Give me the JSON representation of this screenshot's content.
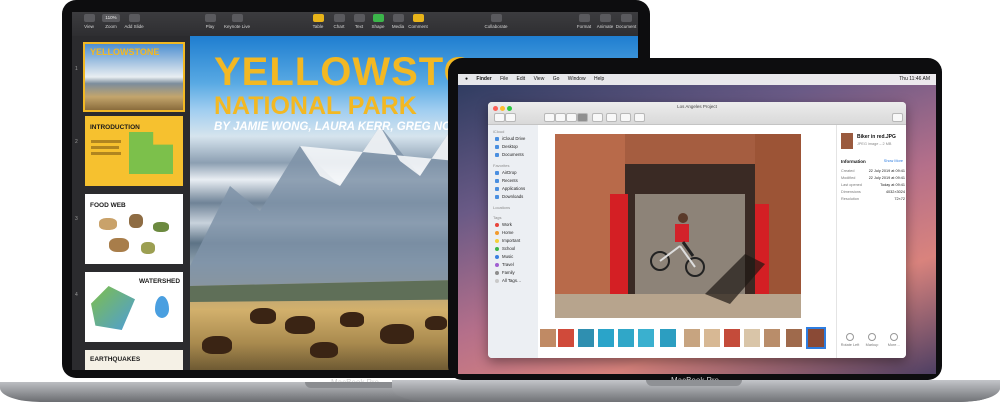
{
  "keynote": {
    "toolbar": [
      {
        "label": "View",
        "icon": "sidebar-icon"
      },
      {
        "label": "Zoom",
        "icon": "zoom-icon",
        "value": "110%"
      },
      {
        "label": "Add Slide",
        "icon": "plus-icon"
      },
      {
        "label": "Play",
        "icon": "play-icon"
      },
      {
        "label": "Keynote Live",
        "icon": "keynote-live-icon"
      },
      {
        "label": "Table",
        "icon": "table-icon"
      },
      {
        "label": "Chart",
        "icon": "chart-icon"
      },
      {
        "label": "Text",
        "icon": "text-icon"
      },
      {
        "label": "Shape",
        "icon": "shape-icon"
      },
      {
        "label": "Media",
        "icon": "media-icon"
      },
      {
        "label": "Comment",
        "icon": "comment-icon"
      },
      {
        "label": "Collaborate",
        "icon": "collaborate-icon"
      },
      {
        "label": "Format",
        "icon": "format-icon"
      },
      {
        "label": "Animate",
        "icon": "animate-icon"
      },
      {
        "label": "Document",
        "icon": "document-icon"
      }
    ],
    "slides": [
      {
        "number": "1",
        "title": "YELLOWSTONE"
      },
      {
        "number": "2",
        "title": "INTRODUCTION"
      },
      {
        "number": "3",
        "title": "FOOD WEB"
      },
      {
        "number": "4",
        "title": "WATERSHED"
      },
      {
        "number": "5",
        "title": "EARTHQUAKES"
      }
    ],
    "canvas": {
      "title": "YELLOWSTO",
      "subtitle": "NATIONAL PARK",
      "byline": "BY JAMIE WONG, LAURA KERR, GREG NOVICK"
    },
    "device_label": "MacBook Pro"
  },
  "finder": {
    "menubar": {
      "items": [
        "Finder",
        "File",
        "Edit",
        "View",
        "Go",
        "Window",
        "Help"
      ],
      "status": "Thu 11:46 AM"
    },
    "window_title": "Los Angeles Project",
    "sidebar": {
      "icloud_header": "iCloud",
      "icloud": [
        "iCloud Drive",
        "Desktop",
        "Documents"
      ],
      "favorites_header": "Favorites",
      "favorites": [
        "AirDrop",
        "Recents",
        "Applications",
        "Downloads"
      ],
      "locations_header": "Locations",
      "tags_header": "Tags",
      "tags": [
        {
          "label": "Work",
          "color": "#e8453c"
        },
        {
          "label": "Home",
          "color": "#f29a2e"
        },
        {
          "label": "Important",
          "color": "#f4cf3a"
        },
        {
          "label": "School",
          "color": "#3db54a"
        },
        {
          "label": "Music",
          "color": "#3a7ee0"
        },
        {
          "label": "Travel",
          "color": "#a15fd1"
        },
        {
          "label": "Family",
          "color": "#8d8d8d"
        },
        {
          "label": "All Tags…",
          "color": "#c9c9c9"
        }
      ]
    },
    "info_panel": {
      "file_name": "Biker in red.JPG",
      "file_type": "JPEG image – 2 MB",
      "section": "Information",
      "show_more": "Show More",
      "rows": [
        {
          "key": "Created",
          "value": "22 July 2019 at 09:41"
        },
        {
          "key": "Modified",
          "value": "22 July 2019 at 09:41"
        },
        {
          "key": "Last opened",
          "value": "Today at 09:41"
        },
        {
          "key": "Dimensions",
          "value": "4032×3024"
        },
        {
          "key": "Resolution",
          "value": "72×72"
        }
      ],
      "actions": [
        "Rotate Left",
        "Markup",
        "More…"
      ]
    },
    "device_label": "MacBook Pro"
  }
}
